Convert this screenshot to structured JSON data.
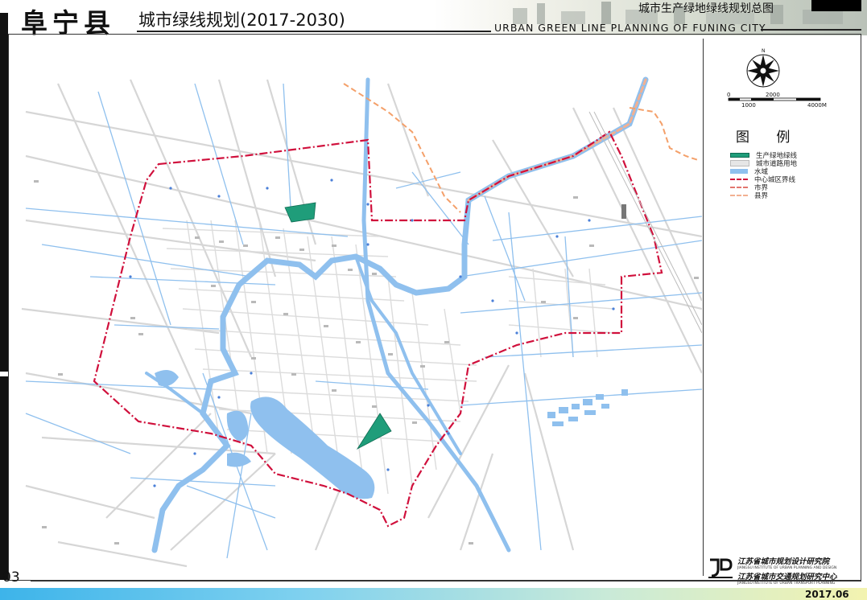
{
  "header": {
    "county": "阜宁县",
    "plan": "城市绿线规划(2017-2030)",
    "sheet": "城市生产绿地绿线规划总图",
    "english": "URBAN GREEN LINE PLANNING OF FUNING CITY"
  },
  "scale": {
    "ticks_top": [
      "0",
      "2000"
    ],
    "ticks_bottom": [
      "1000",
      "4000M"
    ]
  },
  "compass_label": "N",
  "legend": {
    "title": "图 例",
    "items": [
      {
        "label": "生产绿地绿线",
        "color": "#1f9d7a"
      },
      {
        "label": "城市道路用地",
        "color": "#d9d9d9"
      },
      {
        "label": "水域",
        "color": "#8fc0ee"
      },
      {
        "label": "中心城区界线",
        "color": "#d0103c"
      },
      {
        "label": "市界",
        "color": "#e2766e"
      },
      {
        "label": "县界",
        "color": "#f2b091"
      }
    ]
  },
  "colors": {
    "water": "#8fc0ee",
    "road": "#d6d6d6",
    "boundary": "#d0103c",
    "county_border": "#f4a06a",
    "green": "#1f9d7a"
  },
  "page_number": "03",
  "institute": {
    "line1": "江苏省城市规划设计研究院",
    "line1_en": "JIANGSU INSTITUTE OF URBAN PLANNING AND DESIGN",
    "line2": "江苏省城市交通规划研究中心",
    "line2_en": "JIANGSU INSTITUTE OF URBAN TRANSPORT PLANNING"
  },
  "date": "2017.06"
}
